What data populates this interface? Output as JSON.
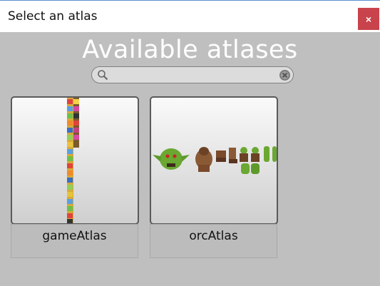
{
  "window": {
    "title": "Select an atlas",
    "close_symbol": "×"
  },
  "heading": "Available atlases",
  "search": {
    "value": "",
    "placeholder": ""
  },
  "atlases": [
    {
      "name": "gameAtlas"
    },
    {
      "name": "orcAtlas"
    }
  ],
  "colors": {
    "background": "#bfbfbf",
    "close_button": "#c8434b",
    "heading": "#ffffff"
  }
}
